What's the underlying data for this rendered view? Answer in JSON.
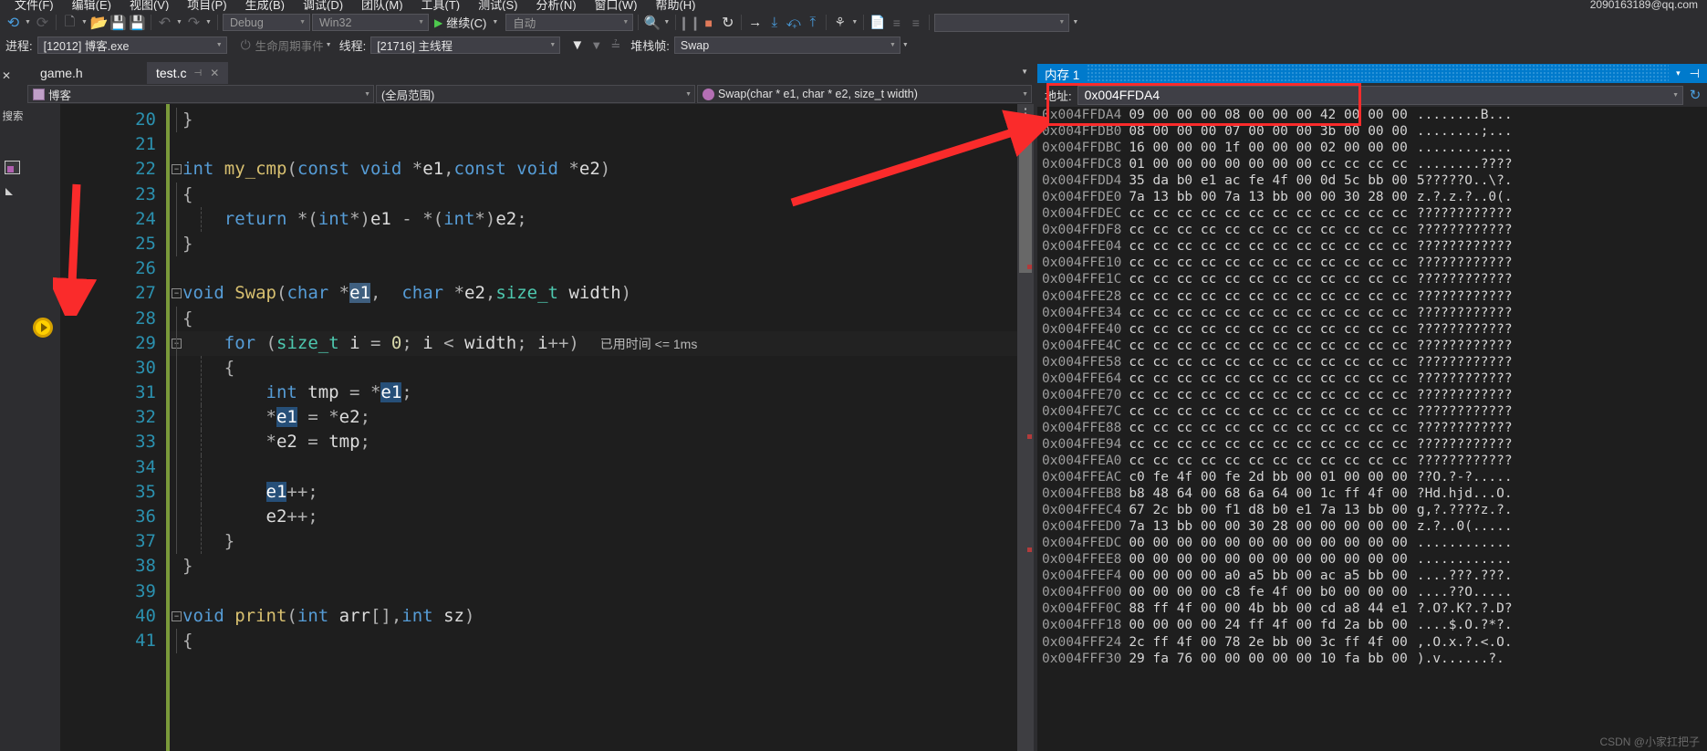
{
  "menu": {
    "items": [
      "文件(F)",
      "编辑(E)",
      "视图(V)",
      "项目(P)",
      "生成(B)",
      "调试(D)",
      "团队(M)",
      "工具(T)",
      "测试(S)",
      "分析(N)",
      "窗口(W)",
      "帮助(H)"
    ],
    "account": "2090163189@qq.com"
  },
  "toolbar": {
    "nav_back": "◀",
    "nav_forward": "▶",
    "new_item": "new-item",
    "open": "open-folder",
    "save": "save",
    "save_all": "save-all",
    "undo": "↶",
    "redo": "↷",
    "config": "Debug",
    "platform": "Win32",
    "continue_label": "继续(C)",
    "attach": "自动",
    "break_all": "❚❚",
    "stop": "■",
    "restart": "↺",
    "show_next": "→",
    "step_into": "⤓",
    "step_over": "⤻",
    "step_out": "⤒",
    "threads": "threads",
    "doc1": "doc",
    "doc2": "indent",
    "doc3": "outdent",
    "find": ""
  },
  "processbar": {
    "process_label": "进程:",
    "process_value": "[12012] 博客.exe",
    "lifecycle_label": "生命周期事件",
    "thread_label": "线程:",
    "thread_value": "[21716] 主线程",
    "stackframe_label": "堆栈帧:",
    "stackframe_value": "Swap"
  },
  "leftrail": {
    "close": "✕",
    "title": "搜索"
  },
  "tabs": [
    {
      "label": "game.h",
      "active": false
    },
    {
      "label": "test.c",
      "active": true,
      "pin": "⊣",
      "close": "✕"
    }
  ],
  "navbar": {
    "project": "博客",
    "scope": "(全局范围)",
    "member": "Swap(char * e1, char * e2, size_t width)"
  },
  "editor": {
    "lines": [
      {
        "n": "20",
        "html": "<span class='pl'>}</span>",
        "fold": "",
        "indent_l1": true
      },
      {
        "n": "21",
        "html": ""
      },
      {
        "n": "22",
        "html": "<span class='kw'>int</span> <span class='fn'>my_cmp</span><span class='pl'>(</span><span class='kw'>const</span> <span class='kw'>void</span> <span class='pl'>*</span>e1<span class='pl'>,</span><span class='kw'>const</span> <span class='kw'>void</span> <span class='pl'>*</span>e2<span class='pl'>)</span>",
        "fold": "−"
      },
      {
        "n": "23",
        "html": "<span class='pl'>{</span>"
      },
      {
        "n": "24",
        "html": "    <span class='kw'>return</span> <span class='pl'>*(</span><span class='kw'>int</span><span class='pl'>*)</span>e1 <span class='pl'>-</span> <span class='pl'>*(</span><span class='kw'>int</span><span class='pl'>*)</span>e2<span class='pl'>;</span>"
      },
      {
        "n": "25",
        "html": "<span class='pl'>}</span>"
      },
      {
        "n": "26",
        "html": ""
      },
      {
        "n": "27",
        "html": "<span class='kw'>void</span> <span class='fn'>Swap</span><span class='pl'>(</span><span class='kw'>char</span> <span class='pl'>*</span><span class='selq'>e1</span><span class='pl'>,</span>  <span class='kw'>char</span> <span class='pl'>*</span>e2<span class='pl'>,</span><span class='ty'>size_t</span> width<span class='pl'>)</span>",
        "fold": "−"
      },
      {
        "n": "28",
        "html": "<span class='pl'>{</span>"
      },
      {
        "n": "29",
        "html": "    <span class='kw'>for</span> <span class='pl'>(</span><span class='ty'>size_t</span> i <span class='pl'>=</span> <span class='num'>0</span><span class='pl'>;</span> i <span class='pl'>&lt;</span> width<span class='pl'>;</span> i<span class='pl'>++)</span>  <span class='hint'>已用时间 &lt;= 1ms</span>",
        "fold": "−",
        "current": true
      },
      {
        "n": "30",
        "html": "    <span class='pl'>{</span>"
      },
      {
        "n": "31",
        "html": "        <span class='kw'>int</span> tmp <span class='pl'>=</span> <span class='pl'>*</span><span class='sel'>e1</span><span class='pl'>;</span>"
      },
      {
        "n": "32",
        "html": "        <span class='pl'>*</span><span class='sel'>e1</span> <span class='pl'>=</span> <span class='pl'>*</span>e2<span class='pl'>;</span>"
      },
      {
        "n": "33",
        "html": "        <span class='pl'>*</span>e2 <span class='pl'>=</span> tmp<span class='pl'>;</span>"
      },
      {
        "n": "34",
        "html": ""
      },
      {
        "n": "35",
        "html": "        <span class='sel'>e1</span><span class='pl'>++;</span>"
      },
      {
        "n": "36",
        "html": "        e2<span class='pl'>++;</span>"
      },
      {
        "n": "37",
        "html": "    <span class='pl'>}</span>"
      },
      {
        "n": "38",
        "html": "<span class='pl'>}</span>"
      },
      {
        "n": "39",
        "html": ""
      },
      {
        "n": "40",
        "html": "<span class='kw'>void</span> <span class='fn'>print</span><span class='pl'>(</span><span class='kw'>int</span> arr<span class='pl'>[],</span><span class='kw'>int</span> sz<span class='pl'>)</span>",
        "fold": "−"
      },
      {
        "n": "41",
        "html": "<span class='pl'>{</span>"
      }
    ]
  },
  "memory": {
    "title": "内存 1",
    "caret": "▾",
    "pin": "⊣",
    "address_label": "地址:",
    "address_value": "0x004FFDA4",
    "refresh": "↻",
    "rows": [
      {
        "addr": "0x004FFDA4",
        "hex": "09 00 00 00 08 00 00 00 42 00 00 00",
        "ascii": "........B..."
      },
      {
        "addr": "0x004FFDB0",
        "hex": "08 00 00 00 07 00 00 00 3b 00 00 00",
        "ascii": "........;..."
      },
      {
        "addr": "0x004FFDBC",
        "hex": "16 00 00 00 1f 00 00 00 02 00 00 00",
        "ascii": "............"
      },
      {
        "addr": "0x004FFDC8",
        "hex": "01 00 00 00 00 00 00 00 cc cc cc cc",
        "ascii": "........????"
      },
      {
        "addr": "0x004FFDD4",
        "hex": "35 da b0 e1 ac fe 4f 00 0d 5c bb 00",
        "ascii": "5?????O..\\?."
      },
      {
        "addr": "0x004FFDE0",
        "hex": "7a 13 bb 00 7a 13 bb 00 00 30 28 00",
        "ascii": "z.?.z.?..0(."
      },
      {
        "addr": "0x004FFDEC",
        "hex": "cc cc cc cc cc cc cc cc cc cc cc cc",
        "ascii": "????????????"
      },
      {
        "addr": "0x004FFDF8",
        "hex": "cc cc cc cc cc cc cc cc cc cc cc cc",
        "ascii": "????????????"
      },
      {
        "addr": "0x004FFE04",
        "hex": "cc cc cc cc cc cc cc cc cc cc cc cc",
        "ascii": "????????????"
      },
      {
        "addr": "0x004FFE10",
        "hex": "cc cc cc cc cc cc cc cc cc cc cc cc",
        "ascii": "????????????"
      },
      {
        "addr": "0x004FFE1C",
        "hex": "cc cc cc cc cc cc cc cc cc cc cc cc",
        "ascii": "????????????"
      },
      {
        "addr": "0x004FFE28",
        "hex": "cc cc cc cc cc cc cc cc cc cc cc cc",
        "ascii": "????????????"
      },
      {
        "addr": "0x004FFE34",
        "hex": "cc cc cc cc cc cc cc cc cc cc cc cc",
        "ascii": "????????????"
      },
      {
        "addr": "0x004FFE40",
        "hex": "cc cc cc cc cc cc cc cc cc cc cc cc",
        "ascii": "????????????"
      },
      {
        "addr": "0x004FFE4C",
        "hex": "cc cc cc cc cc cc cc cc cc cc cc cc",
        "ascii": "????????????"
      },
      {
        "addr": "0x004FFE58",
        "hex": "cc cc cc cc cc cc cc cc cc cc cc cc",
        "ascii": "????????????"
      },
      {
        "addr": "0x004FFE64",
        "hex": "cc cc cc cc cc cc cc cc cc cc cc cc",
        "ascii": "????????????"
      },
      {
        "addr": "0x004FFE70",
        "hex": "cc cc cc cc cc cc cc cc cc cc cc cc",
        "ascii": "????????????"
      },
      {
        "addr": "0x004FFE7C",
        "hex": "cc cc cc cc cc cc cc cc cc cc cc cc",
        "ascii": "????????????"
      },
      {
        "addr": "0x004FFE88",
        "hex": "cc cc cc cc cc cc cc cc cc cc cc cc",
        "ascii": "????????????"
      },
      {
        "addr": "0x004FFE94",
        "hex": "cc cc cc cc cc cc cc cc cc cc cc cc",
        "ascii": "????????????"
      },
      {
        "addr": "0x004FFEA0",
        "hex": "cc cc cc cc cc cc cc cc cc cc cc cc",
        "ascii": "????????????"
      },
      {
        "addr": "0x004FFEAC",
        "hex": "c0 fe 4f 00 fe 2d bb 00 01 00 00 00",
        "ascii": "??O.?-?....."
      },
      {
        "addr": "0x004FFEB8",
        "hex": "b8 48 64 00 68 6a 64 00 1c ff 4f 00",
        "ascii": "?Hd.hjd...O."
      },
      {
        "addr": "0x004FFEC4",
        "hex": "67 2c bb 00 f1 d8 b0 e1 7a 13 bb 00",
        "ascii": "g,?.????z.?."
      },
      {
        "addr": "0x004FFED0",
        "hex": "7a 13 bb 00 00 30 28 00 00 00 00 00",
        "ascii": "z.?..0(....."
      },
      {
        "addr": "0x004FFEDC",
        "hex": "00 00 00 00 00 00 00 00 00 00 00 00",
        "ascii": "............"
      },
      {
        "addr": "0x004FFEE8",
        "hex": "00 00 00 00 00 00 00 00 00 00 00 00",
        "ascii": "............"
      },
      {
        "addr": "0x004FFEF4",
        "hex": "00 00 00 00 a0 a5 bb 00 ac a5 bb 00",
        "ascii": "....???.???."
      },
      {
        "addr": "0x004FFF00",
        "hex": "00 00 00 00 c8 fe 4f 00 b0 00 00 00",
        "ascii": "....??O....."
      },
      {
        "addr": "0x004FFF0C",
        "hex": "88 ff 4f 00 00 4b bb 00 cd a8 44 e1",
        "ascii": "?.O?.K?.?.D?"
      },
      {
        "addr": "0x004FFF18",
        "hex": "00 00 00 00 24 ff 4f 00 fd 2a bb 00",
        "ascii": "....$.O.?*?."
      },
      {
        "addr": "0x004FFF24",
        "hex": "2c ff 4f 00 78 2e bb 00 3c ff 4f 00",
        "ascii": ",.O.x.?.<.O."
      },
      {
        "addr": "0x004FFF30",
        "hex": "29 fa 76 00 00 00 00 00 10 fa bb 00",
        "ascii": ").v......?."
      }
    ]
  },
  "watermark": "CSDN @小家扛把子"
}
